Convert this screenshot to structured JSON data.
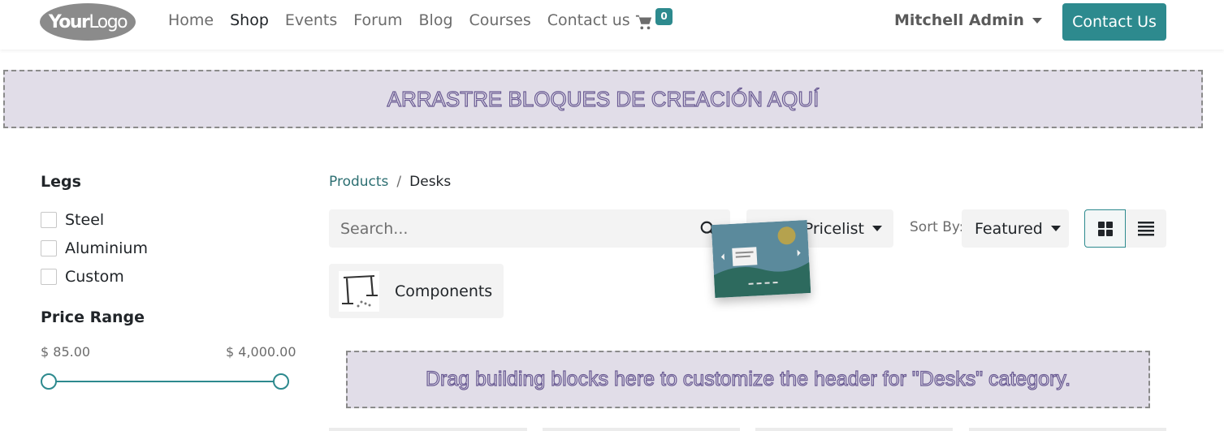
{
  "header": {
    "logo_bold": "Your",
    "logo_light": "Logo",
    "nav": [
      {
        "label": "Home",
        "active": false
      },
      {
        "label": "Shop",
        "active": true
      },
      {
        "label": "Events",
        "active": false
      },
      {
        "label": "Forum",
        "active": false
      },
      {
        "label": "Blog",
        "active": false
      },
      {
        "label": "Courses",
        "active": false
      },
      {
        "label": "Contact us",
        "active": false
      }
    ],
    "cart_icon": "shopping-cart-icon",
    "cart_count": "0",
    "user_name": "Mitchell Admin",
    "contact_button": "Contact Us"
  },
  "dropzones": {
    "top": "ARRASTRE BLOQUES DE CREACIÓN AQUÍ",
    "category_header": "Drag building blocks here to customize the header for \"Desks\" category."
  },
  "filters": {
    "legs": {
      "title": "Legs",
      "options": [
        "Steel",
        "Aluminium",
        "Custom"
      ]
    },
    "price_range": {
      "title": "Price Range",
      "min_label": "$ 85.00",
      "max_label": "$ 4,000.00"
    }
  },
  "breadcrumb": {
    "parent": "Products",
    "separator": "/",
    "current": "Desks"
  },
  "toolbar": {
    "search_placeholder": "Search...",
    "pricelist_visible_text": "Pricelist",
    "sort_label": "Sort By:",
    "sort_value": "Featured",
    "view_modes": [
      "grid-view-icon",
      "list-view-icon"
    ],
    "active_view": "grid"
  },
  "categories": [
    {
      "label": "Components"
    }
  ],
  "colors": {
    "accent": "#2d8a8e",
    "dropzone_bg": "#e1dde8",
    "dropzone_text": "#6a5b93"
  }
}
